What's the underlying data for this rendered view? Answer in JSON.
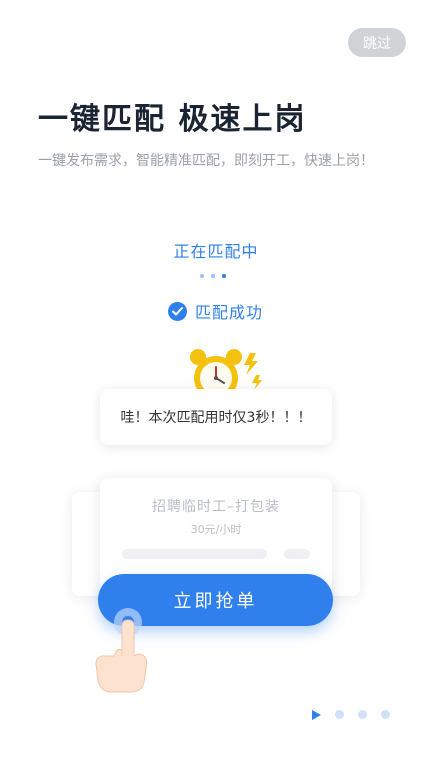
{
  "header": {
    "skip_label": "跳过",
    "headline": "一键匹配  极速上岗",
    "subtitle": "一键发布需求，智能精准匹配，即刻开工，快速上岗！"
  },
  "matching": {
    "status": "正在匹配中",
    "success": "匹配成功",
    "time_message": "哇！本次匹配用时仅3秒！！！"
  },
  "job_card": {
    "title": "招聘临时工–打包装",
    "wage": "30元/小时",
    "grab_button": "立即抢单"
  },
  "pager": {
    "count": 4,
    "active": 0
  },
  "colors": {
    "accent": "#2f80ed",
    "headline": "#1b2433",
    "muted": "#9aa1ab",
    "clock": "#f4c20d"
  },
  "icons": [
    "check-icon",
    "alarm-clock-icon",
    "lightning-icon",
    "pointing-hand-icon",
    "play-icon"
  ]
}
